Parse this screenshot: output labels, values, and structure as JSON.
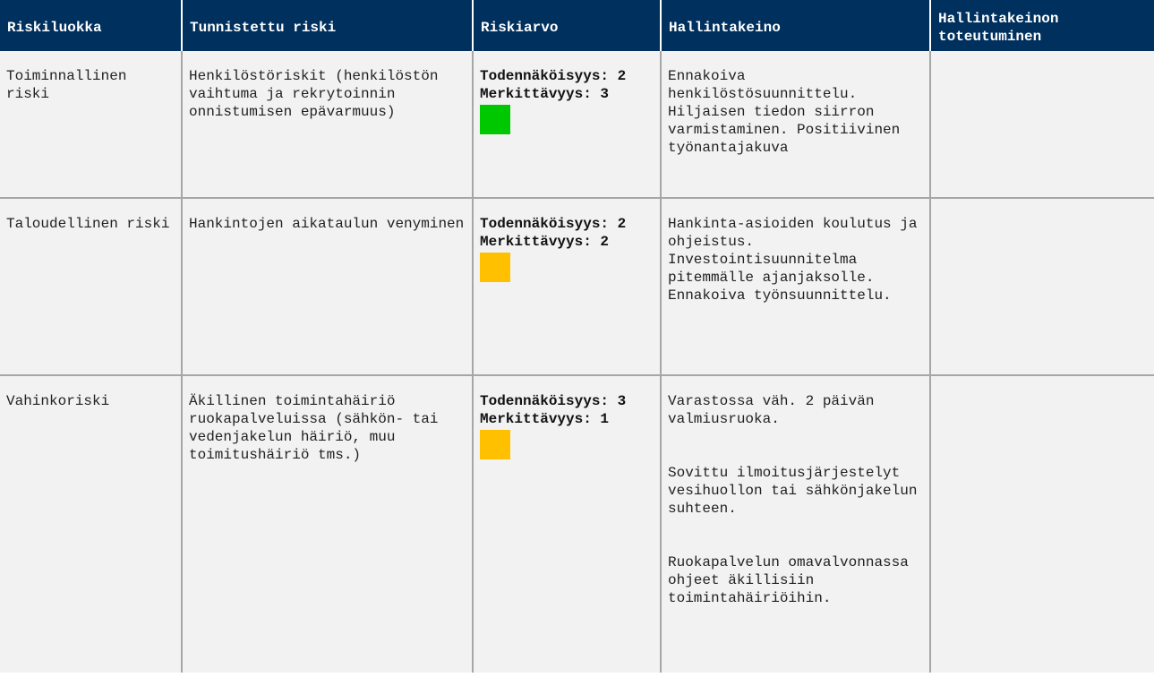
{
  "colors": {
    "header_bg": "#00305e",
    "header_text": "#ffffff",
    "cell_bg": "#f2f2f2",
    "border": "#a6a6a6",
    "green": "#00c800",
    "amber": "#ffc000"
  },
  "headers": {
    "riskiluokka": "Riskiluokka",
    "tunnistettu": "Tunnistettu riski",
    "riskiarvo": "Riskiarvo",
    "hallintakeino": "Hallintakeino",
    "toteutuminen": "Hallintakeinon toteutuminen"
  },
  "rows": [
    {
      "riskiluokka": "Toiminnallinen riski",
      "tunnistettu": "Henkilöstöriskit (henkilöstön vaihtuma ja rekrytoinnin onnistumisen epävarmuus)",
      "todennakoisyys": "Todennäköisyys: 2",
      "merkittavyys": "Merkittävyys: 3",
      "level_color": "green",
      "hallintakeino": [
        "Ennakoiva henkilöstösuunnittelu. Hiljaisen tiedon siirron varmistaminen. Positiivinen työnantajakuva"
      ],
      "toteutuminen": ""
    },
    {
      "riskiluokka": "Taloudellinen riski",
      "tunnistettu": "Hankintojen aikataulun venyminen",
      "todennakoisyys": "Todennäköisyys: 2",
      "merkittavyys": "Merkittävyys: 2",
      "level_color": "amber",
      "hallintakeino": [
        "Hankinta-asioiden koulutus ja ohjeistus. Investointisuunnitelma pitemmälle ajanjaksolle. Ennakoiva työnsuunnittelu."
      ],
      "toteutuminen": ""
    },
    {
      "riskiluokka": "Vahinkoriski",
      "tunnistettu": "Äkillinen toimintahäiriö ruokapalveluissa (sähkön- tai vedenjakelun häiriö, muu toimitushäiriö tms.)",
      "todennakoisyys": "Todennäköisyys: 3",
      "merkittavyys": "Merkittävyys: 1",
      "level_color": "amber",
      "hallintakeino": [
        "Varastossa väh. 2 päivän valmiusruoka.",
        "Sovittu ilmoitusjärjestelyt vesihuollon tai sähkönjakelun suhteen.",
        "Ruokapalvelun omavalvonnassa ohjeet äkillisiin toimintahäiriöihin."
      ],
      "toteutuminen": ""
    }
  ]
}
